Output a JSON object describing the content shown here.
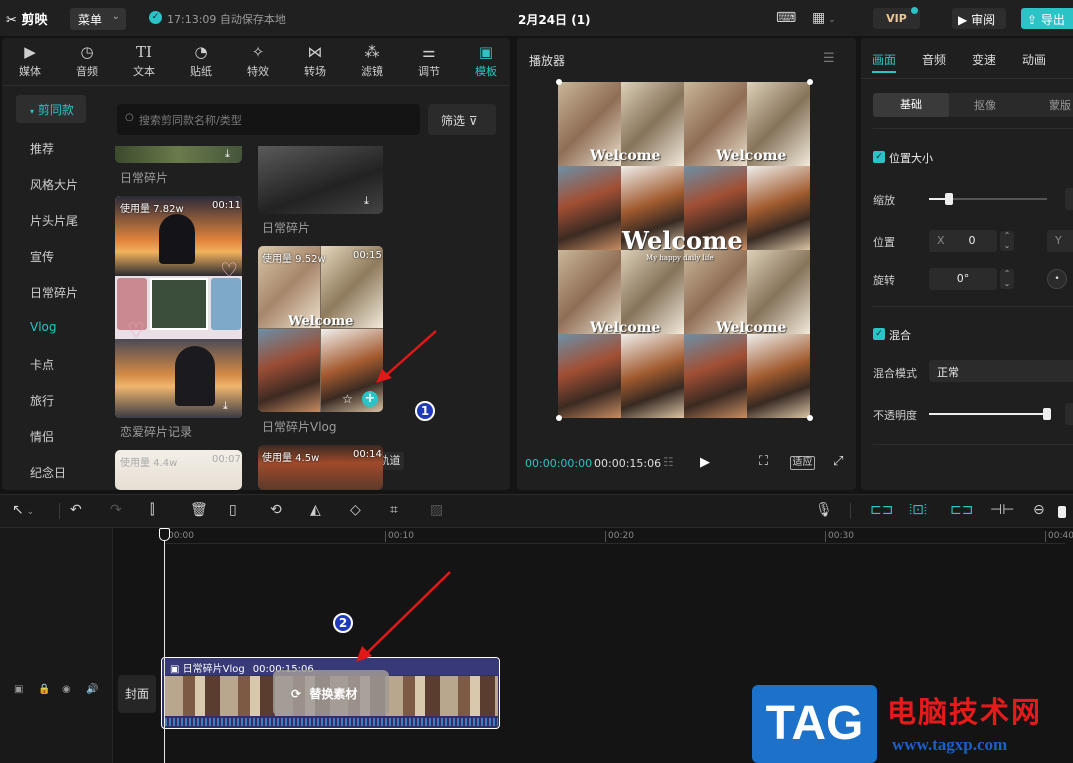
{
  "topbar": {
    "logo": "剪映",
    "menu": "菜单",
    "save_status": "17:13:09 自动保存本地",
    "project_title": "2月24日 (1)",
    "vip": "VIP",
    "review": "审阅",
    "export": "导出"
  },
  "media_tabs": [
    {
      "label": "媒体",
      "icon": "media-icon"
    },
    {
      "label": "音频",
      "icon": "audio-icon"
    },
    {
      "label": "文本",
      "icon": "text-icon"
    },
    {
      "label": "贴纸",
      "icon": "sticker-icon"
    },
    {
      "label": "特效",
      "icon": "effects-icon"
    },
    {
      "label": "转场",
      "icon": "transition-icon"
    },
    {
      "label": "滤镜",
      "icon": "filter-icon"
    },
    {
      "label": "调节",
      "icon": "adjust-icon"
    },
    {
      "label": "模板",
      "icon": "template-icon",
      "active": true
    }
  ],
  "categories": {
    "header": "剪同款",
    "items": [
      "推荐",
      "风格大片",
      "片头片尾",
      "宣传",
      "日常碎片",
      "Vlog",
      "卡点",
      "旅行",
      "情侣",
      "纪念日"
    ]
  },
  "search": {
    "placeholder": "搜索剪同款名称/类型",
    "filter": "筛选"
  },
  "templates": {
    "top_left_caption": "日常碎片",
    "top_right_caption": "日常碎片",
    "card1": {
      "usage": "使用量 7.82w",
      "duration": "00:11",
      "caption": "恋爱碎片记录"
    },
    "card2": {
      "usage": "使用量 9.52w",
      "duration": "00:15",
      "caption": "日常碎片Vlog",
      "tooltip": "添加到轨道"
    },
    "card3": {
      "usage": "使用量 4.5w",
      "duration": "00:14"
    },
    "card4": {
      "usage": "使用量 4.4w",
      "duration": "00:07"
    }
  },
  "player": {
    "title": "播放器",
    "current_time": "00:00:00:00",
    "total_time": "00:00:15:06",
    "fit": "适应",
    "video_text_big": "Welcome",
    "video_text_small": "My happy daily life"
  },
  "inspector": {
    "tabs": [
      "画面",
      "音频",
      "变速",
      "动画"
    ],
    "subtabs": [
      "基础",
      "抠像",
      "蒙版"
    ],
    "position_size": "位置大小",
    "scale": "缩放",
    "position": "位置",
    "pos_x_label": "X",
    "pos_x_value": "0",
    "pos_y_label": "Y",
    "rotate": "旋转",
    "rotate_value": "0°",
    "blend": "混合",
    "blend_mode": "混合模式",
    "blend_mode_value": "正常",
    "opacity": "不透明度",
    "scale_level": 0.17,
    "opacity_level": 1.0
  },
  "timeline": {
    "ticks": [
      "00:00",
      "00:10",
      "00:20",
      "00:30",
      "00:40"
    ],
    "cover": "封面",
    "clip_title": "日常碎片Vlog",
    "clip_duration": "00:00:15:06",
    "replace": "替换素材"
  },
  "annotations": {
    "marker1": "1",
    "marker2": "2"
  },
  "watermark": {
    "tag": "TAG",
    "name": "电脑技术网",
    "url": "www.tagxp.com"
  },
  "colors": {
    "accent": "#2bc3c5",
    "clip": "#373a76",
    "annotation_arrow": "#e01818",
    "marker": "#1e3ab8"
  }
}
